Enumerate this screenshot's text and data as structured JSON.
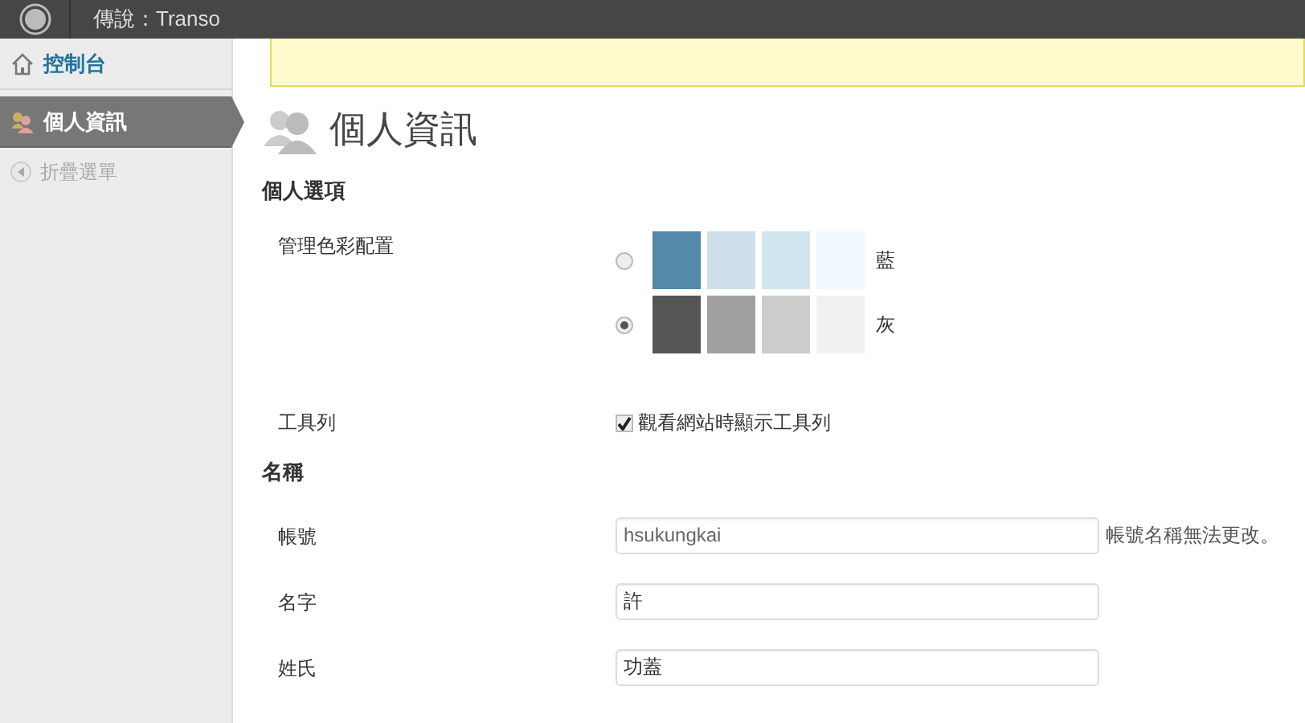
{
  "admin_bar": {
    "site_title": "傳說：Transo"
  },
  "sidebar": {
    "items": [
      {
        "label": "控制台",
        "kind": "home",
        "selected": false
      },
      {
        "label": "個人資訊",
        "kind": "users",
        "selected": true
      }
    ],
    "collapse_label": "折疊選單"
  },
  "page_title": "個人資訊",
  "sections": [
    {
      "heading": "個人選項",
      "rows": [
        {
          "kind": "schemes",
          "label": "管理色彩配置",
          "schemes": [
            {
              "name": "藍",
              "selected": false,
              "swatches": [
                {
                  "color": "#5589aa"
                },
                {
                  "color": "#cfdfe9"
                },
                {
                  "color": "#d1e5ee"
                },
                {
                  "color": "#eff8ff"
                }
              ]
            },
            {
              "name": "灰",
              "selected": true,
              "swatches": [
                {
                  "color": "#555555"
                },
                {
                  "color": "#a0a0a0"
                },
                {
                  "color": "#cccccc"
                },
                {
                  "color": "#f1f1f1"
                }
              ]
            }
          ]
        },
        {
          "kind": "checkbox",
          "label": "工具列",
          "text": "觀看網站時顯示工具列",
          "checked": true
        }
      ]
    },
    {
      "heading": "名稱",
      "rows": [
        {
          "kind": "field",
          "label": "帳號",
          "value": "hsukungkai",
          "disabled": true,
          "hint": "帳號名稱無法更改。"
        },
        {
          "kind": "field",
          "label": "名字",
          "value": "許",
          "disabled": false
        },
        {
          "kind": "field",
          "label": "姓氏",
          "value": "功蓋",
          "disabled": false
        }
      ]
    }
  ]
}
